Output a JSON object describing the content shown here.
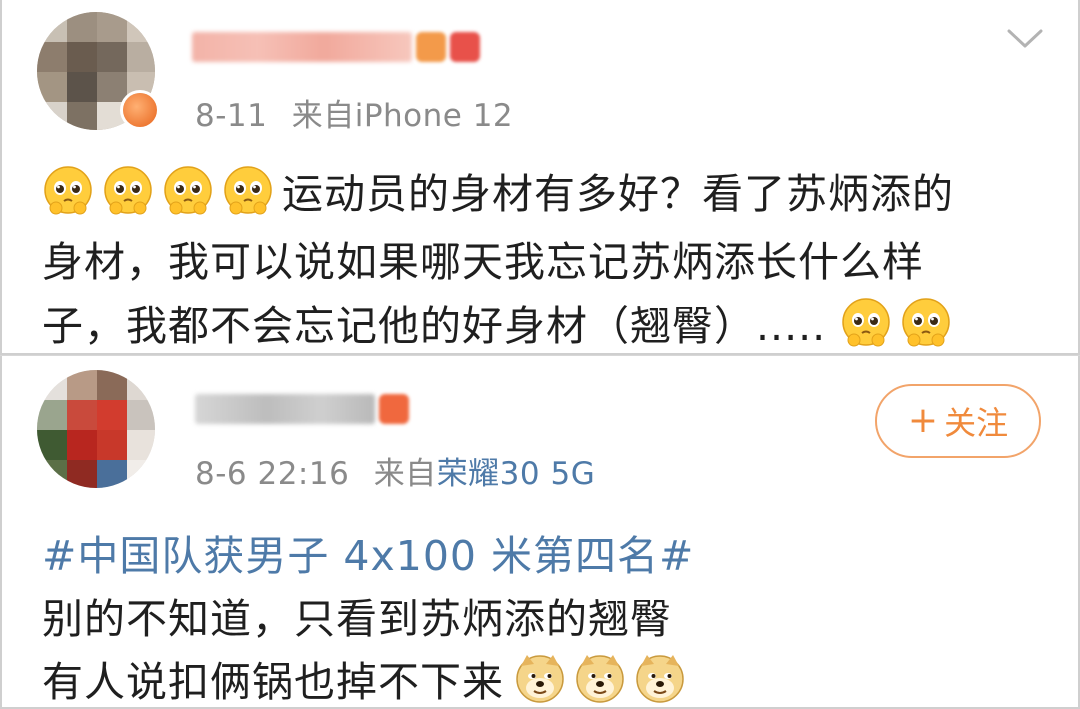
{
  "posts": [
    {
      "date": "8-11",
      "source_prefix": "来自",
      "source": "iPhone 12",
      "text_line1": "运动员的身材有多好？看了苏炳添的",
      "text_line2": "身材，我可以说如果哪天我忘记苏炳添长什么样",
      "text_line3": "子，我都不会忘记他的好身材（翘臀）.....",
      "emoji": "shy-face-emoji",
      "menu_icon": "chevron-down-icon"
    },
    {
      "date": "8-6 22:16",
      "source_prefix": "来自",
      "source": "荣耀30 5G",
      "follow_plus": "+",
      "follow_label": "关注",
      "topic": "#中国队获男子 4x100 米第四名#",
      "text_line1": "别的不知道，只看到苏炳添的翘臀",
      "text_line2": "有人说扣俩锅也掉不下来",
      "emoji": "doge-emoji"
    }
  ],
  "colors": {
    "meta_gray": "#8a8a8a",
    "link_blue": "#4e7aa8",
    "follow_orange": "#f08a3c",
    "follow_border": "#f2a46a"
  }
}
